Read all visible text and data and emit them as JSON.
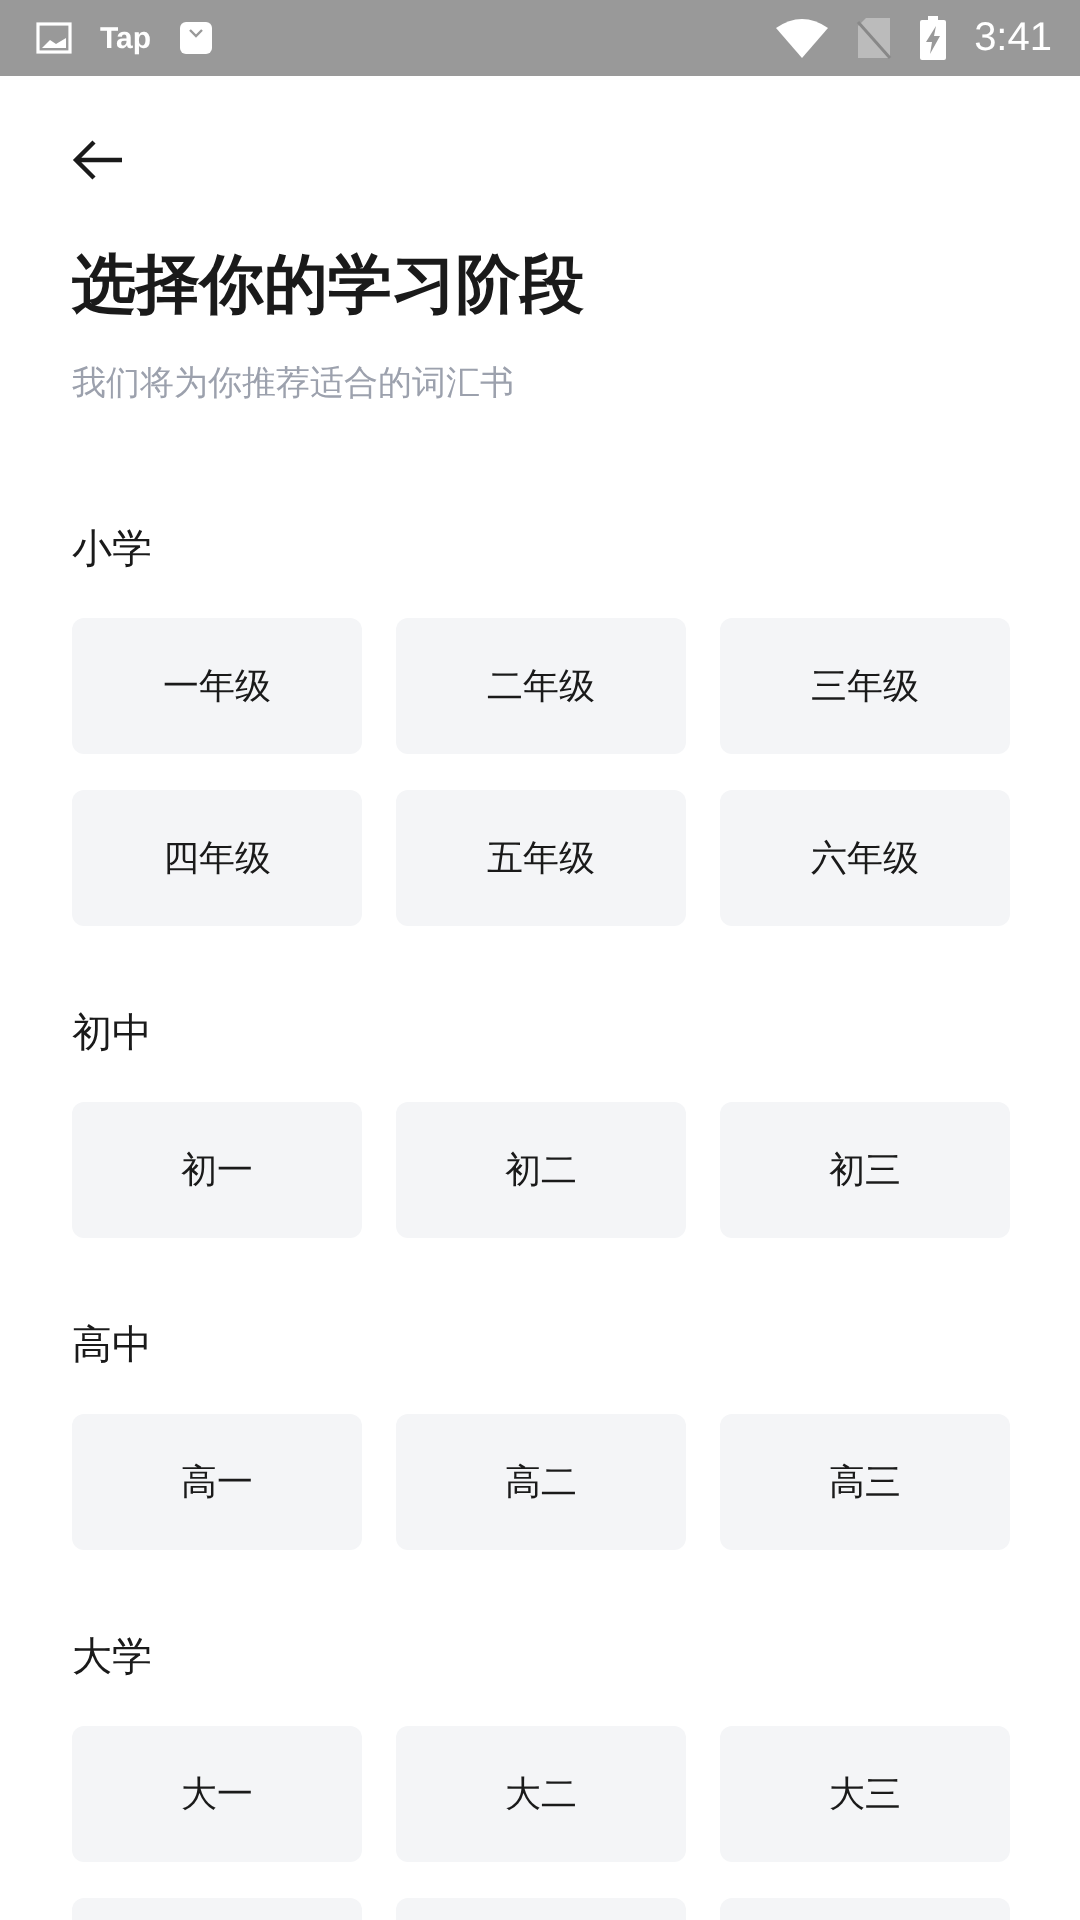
{
  "status_bar": {
    "app_label": "Tap",
    "time": "3:41"
  },
  "header": {
    "title": "选择你的学习阶段",
    "subtitle": "我们将为你推荐适合的词汇书"
  },
  "sections": [
    {
      "label": "小学",
      "options": [
        "一年级",
        "二年级",
        "三年级",
        "四年级",
        "五年级",
        "六年级"
      ]
    },
    {
      "label": "初中",
      "options": [
        "初一",
        "初二",
        "初三"
      ]
    },
    {
      "label": "高中",
      "options": [
        "高一",
        "高二",
        "高三"
      ]
    },
    {
      "label": "大学",
      "options": [
        "大一",
        "大二",
        "大三"
      ]
    }
  ]
}
